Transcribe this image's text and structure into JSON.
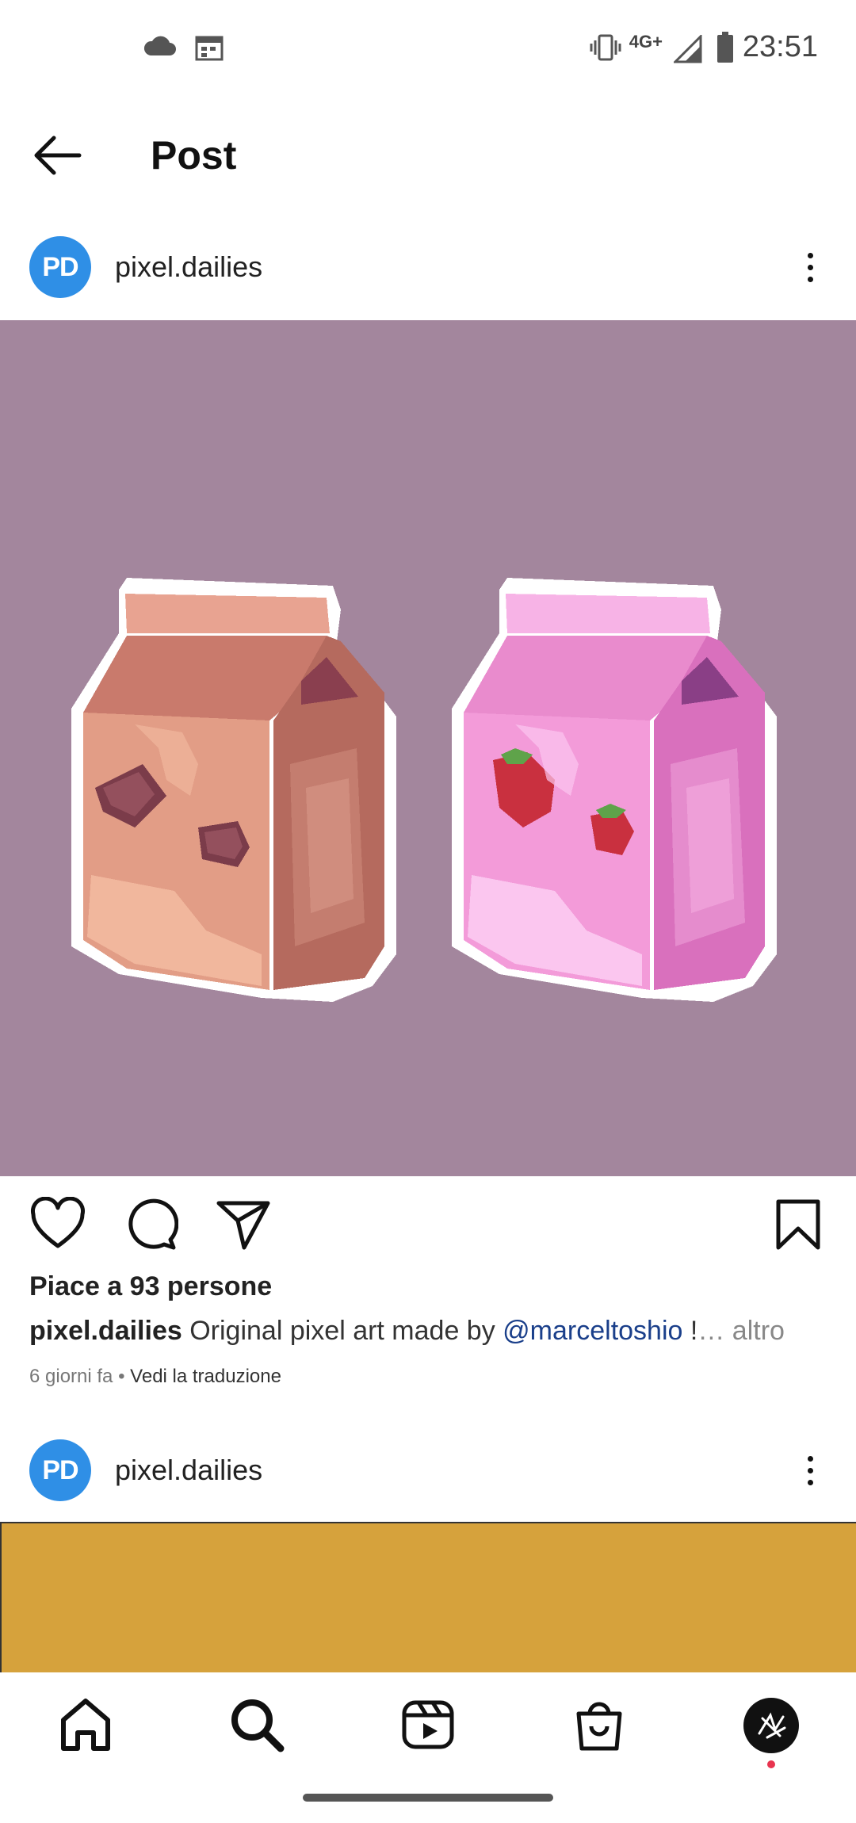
{
  "status_bar": {
    "time": "23:51",
    "network": "4G+",
    "icons": [
      "cloud-icon",
      "calendar-icon",
      "vibrate-icon",
      "signal-icon",
      "battery-icon"
    ]
  },
  "header": {
    "title": "Post",
    "back_icon": "back-arrow-icon"
  },
  "post": {
    "avatar_text": "PD",
    "username": "pixel.dailies",
    "likes_text": "Piace a 93 persone",
    "caption": {
      "username": "pixel.dailies",
      "text": " Original pixel art made by ",
      "mention": "@marceltoshio",
      "tail": " !",
      "more": "… altro"
    },
    "time_ago": "6 giorni fa",
    "separator": " • ",
    "translate": "Vedi la traduzione",
    "image_bg": "#a3869d"
  },
  "next_post": {
    "avatar_text": "PD",
    "username": "pixel.dailies"
  },
  "bottom_nav": {
    "items": [
      "home-icon",
      "search-icon",
      "reels-icon",
      "shop-icon",
      "profile-avatar"
    ]
  },
  "colors": {
    "accent_blue": "#2f8fe6",
    "mention": "#1a3f8a",
    "notification_dot": "#e8344f"
  }
}
